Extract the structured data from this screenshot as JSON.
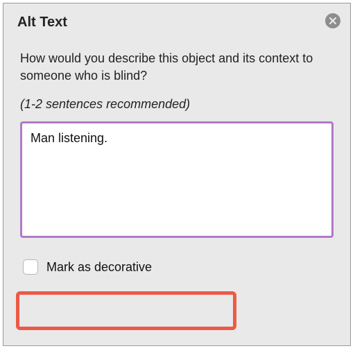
{
  "panel": {
    "title": "Alt Text",
    "prompt": "How would you describe this object and its context to someone who is blind?",
    "hint": "(1-2 sentences recommended)",
    "textarea_value": "Man listening.",
    "decorative_label": "Mark as decorative"
  }
}
